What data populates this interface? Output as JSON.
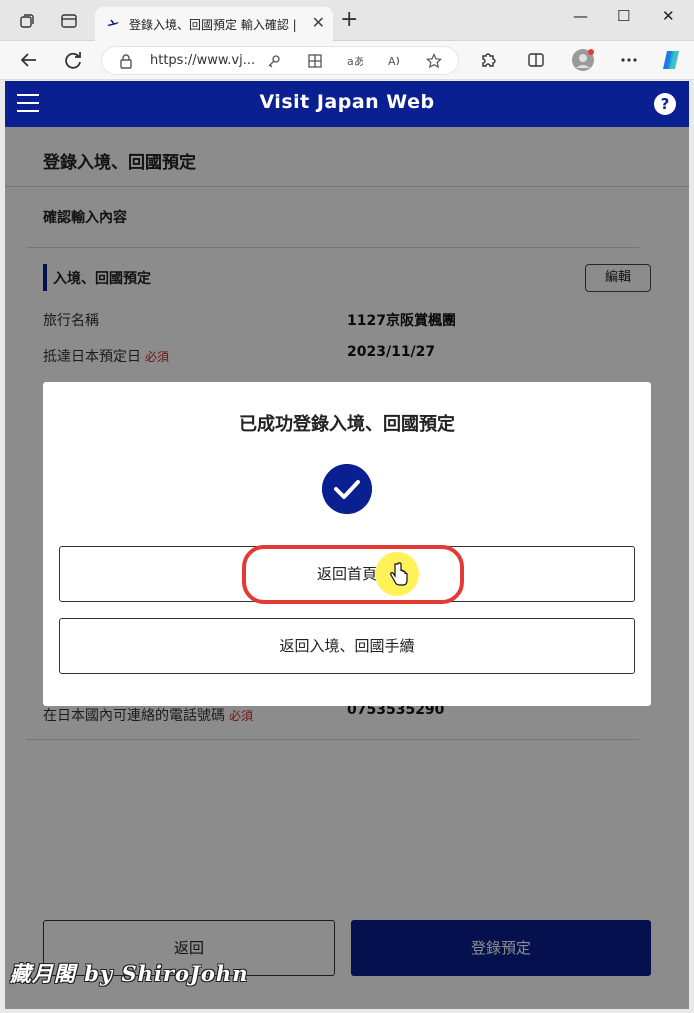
{
  "browser": {
    "tab_title": "登錄入境、回國預定 輸入確認 | V",
    "tab_close": "✕",
    "new_tab": "+",
    "url": "https://www.vj...",
    "window": {
      "minimize": "—",
      "maximize": "☐",
      "close": "✕"
    }
  },
  "app": {
    "brand": "Visit Japan Web",
    "help": "?"
  },
  "page": {
    "title": "登錄入境、回國預定",
    "subtitle": "確認輸入內容",
    "section_title": "入境、回國預定",
    "edit_label": "編輯",
    "required_label": "必須",
    "fields": [
      {
        "label": "旅行名稱",
        "value": "1127京阪賞楓團"
      },
      {
        "label": "抵達日本預定日",
        "value": "2023/11/27"
      },
      {
        "label": "在日本國內可連絡的電話號碼",
        "value": "0753535290"
      }
    ],
    "back_label": "返回",
    "register_label": "登錄預定"
  },
  "modal": {
    "title": "已成功登錄入境、回國預定",
    "home_button": "返回首頁",
    "procedures_button": "返回入境、回國手續"
  },
  "watermark": "藏月閣 by ShiroJohn",
  "colors": {
    "brand_blue": "#0a1f90",
    "required_red": "#c62828",
    "highlight_red": "#e53935"
  },
  "icons": [
    "tab-actions-icon",
    "tab-list-icon",
    "favicon-icon",
    "back-icon",
    "refresh-icon",
    "lock-icon",
    "key-icon",
    "apps-icon",
    "read-aloud-icon",
    "reader-icon",
    "favorite-icon",
    "extensions-icon",
    "split-screen-icon",
    "profile-icon",
    "more-icon",
    "copilot-icon",
    "hamburger-icon",
    "help-icon",
    "check-icon",
    "hand-cursor-icon"
  ]
}
